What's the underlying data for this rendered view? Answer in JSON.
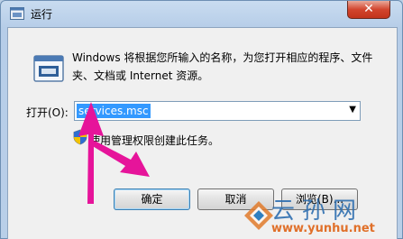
{
  "window": {
    "title": "运行"
  },
  "titlebar": {
    "close_glyph": "✕"
  },
  "dialog": {
    "description": "Windows 将根据您所输入的名称，为您打开相应的程序、文件夹、文档或 Internet 资源。",
    "open_label": "打开(O):",
    "command_value": "services.msc",
    "dropdown_glyph": "▼",
    "admin_note": "使用管理权限创建此任务。"
  },
  "buttons": {
    "ok": "确定",
    "cancel": "取消",
    "browse": "浏览(B)..."
  },
  "watermark": {
    "text": "云孙网",
    "url": "www.yunhu.net"
  },
  "colors": {
    "selection": "#3399ff",
    "close_button": "#d2452e",
    "annotation_arrow": "#e6149a"
  }
}
